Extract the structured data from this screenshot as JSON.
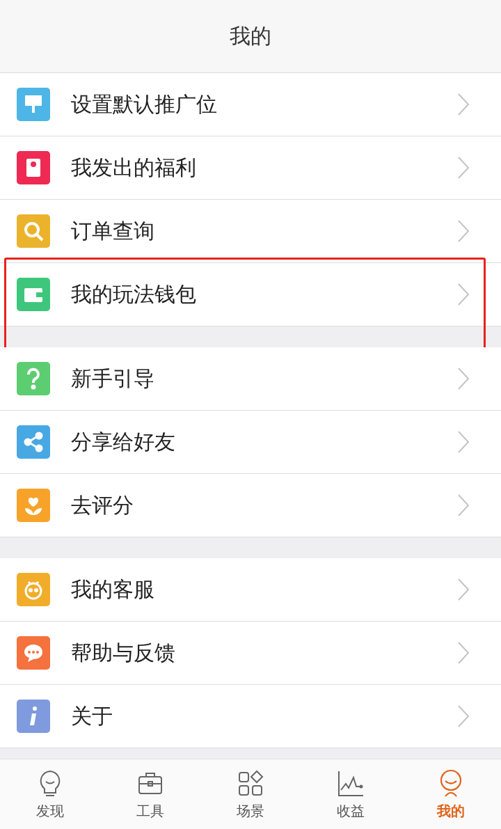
{
  "header": {
    "title": "我的"
  },
  "groups": [
    {
      "items": [
        {
          "label": "设置默认推广位",
          "color": "#4db6e6",
          "highlighted": false
        },
        {
          "label": "我发出的福利",
          "color": "#ee2a52",
          "highlighted": false
        },
        {
          "label": "订单查询",
          "color": "#ebb32c",
          "highlighted": false
        },
        {
          "label": "我的玩法钱包",
          "color": "#3ec77c",
          "highlighted": true
        }
      ]
    },
    {
      "items": [
        {
          "label": "新手引导",
          "color": "#5ccd71",
          "highlighted": false
        },
        {
          "label": "分享给好友",
          "color": "#47a8e4",
          "highlighted": false
        },
        {
          "label": "去评分",
          "color": "#f7a32a",
          "highlighted": false
        }
      ]
    },
    {
      "items": [
        {
          "label": "我的客服",
          "color": "#f1ad2a",
          "highlighted": false
        },
        {
          "label": "帮助与反馈",
          "color": "#f5713d",
          "highlighted": false
        },
        {
          "label": "关于",
          "color": "#7f9bdd",
          "highlighted": false
        }
      ]
    }
  ],
  "tab_bar": [
    {
      "label": "发现",
      "selected": false
    },
    {
      "label": "工具",
      "selected": false
    },
    {
      "label": "场景",
      "selected": false
    },
    {
      "label": "收益",
      "selected": false
    },
    {
      "label": "我的",
      "selected": true
    }
  ]
}
